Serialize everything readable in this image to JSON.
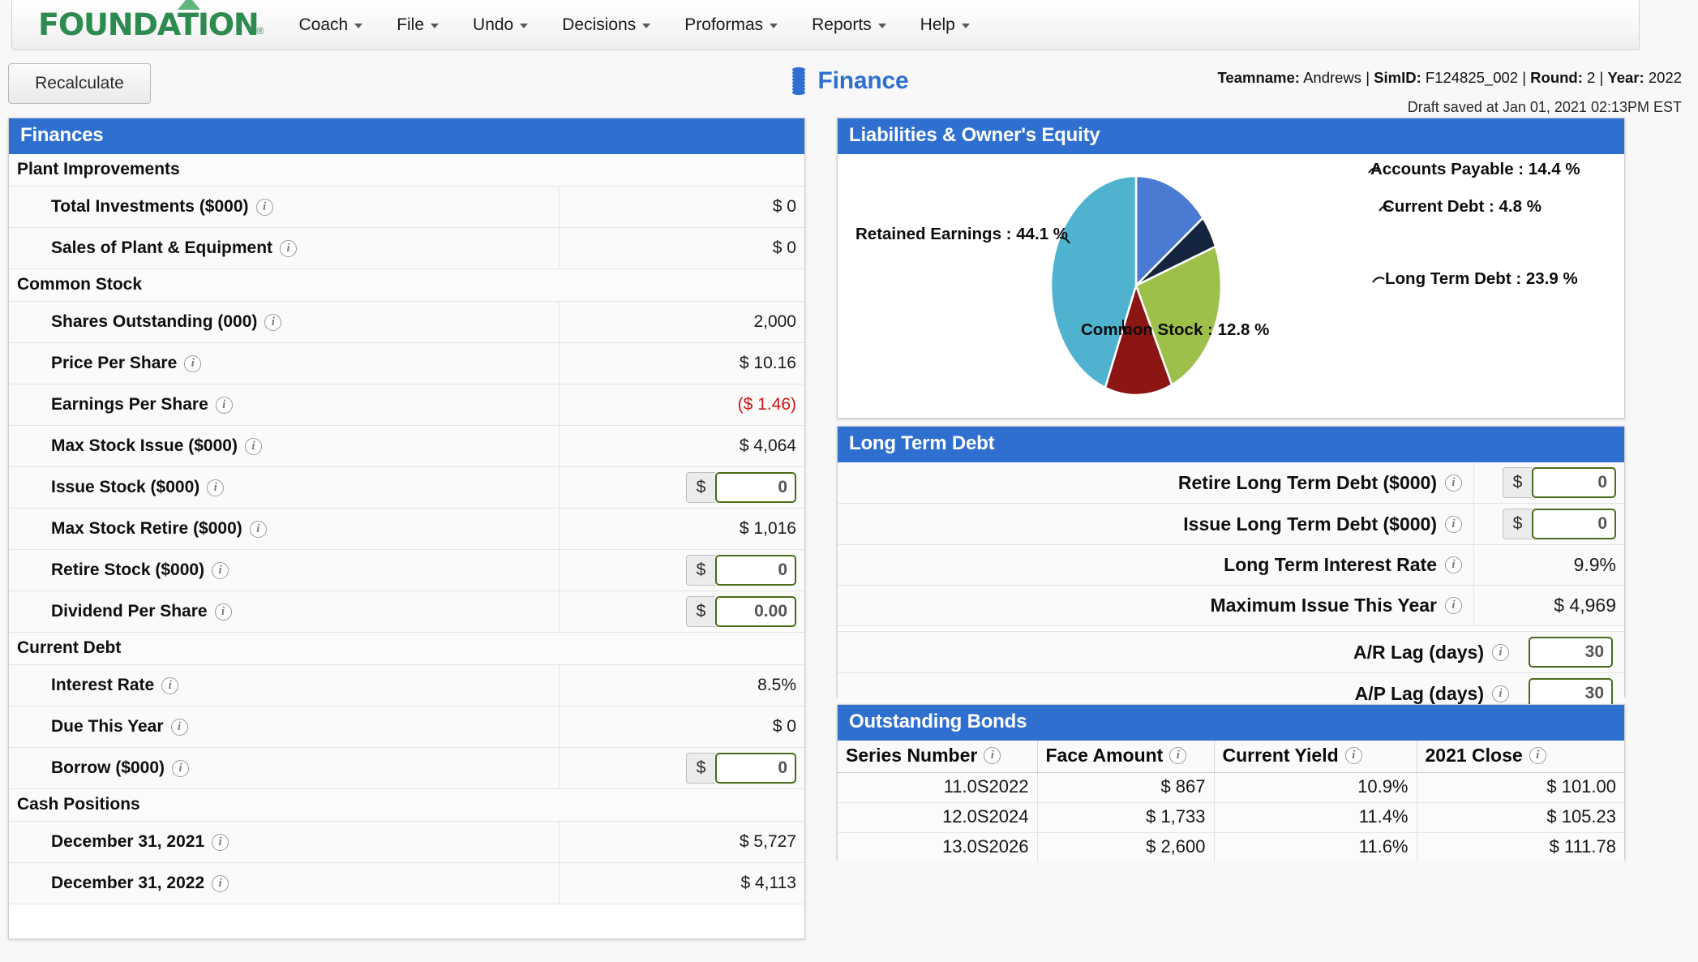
{
  "brand": {
    "name": "FOUNDATION",
    "registered": "®"
  },
  "menu": [
    {
      "label": "Coach"
    },
    {
      "label": "File"
    },
    {
      "label": "Undo"
    },
    {
      "label": "Decisions"
    },
    {
      "label": "Proformas"
    },
    {
      "label": "Reports"
    },
    {
      "label": "Help"
    }
  ],
  "toolbar": {
    "recalculate_label": "Recalculate"
  },
  "page": {
    "title": "Finance",
    "icon": "coins-icon",
    "title_color": "#2f6fd0"
  },
  "meta": {
    "teamname_label": "Teamname:",
    "teamname": "Andrews",
    "simid_label": "SimID:",
    "simid": "F124825_002",
    "round_label": "Round:",
    "round": "2",
    "year_label": "Year:",
    "year": "2022",
    "sep": "|",
    "draft_saved": "Draft saved at Jan 01, 2021 02:13PM EST"
  },
  "finances": {
    "title": "Finances",
    "groups": [
      {
        "name": "Plant Improvements",
        "rows": [
          {
            "label": "Total Investments ($000)",
            "value": "$ 0",
            "type": "text"
          },
          {
            "label": "Sales of Plant & Equipment",
            "value": "$ 0",
            "type": "text"
          }
        ]
      },
      {
        "name": "Common Stock",
        "rows": [
          {
            "label": "Shares Outstanding (000)",
            "value": "2,000",
            "type": "text"
          },
          {
            "label": "Price Per Share",
            "value": "$ 10.16",
            "type": "text"
          },
          {
            "label": "Earnings Per Share",
            "value": "($ 1.46)",
            "type": "text",
            "negative": true
          },
          {
            "label": "Max Stock Issue ($000)",
            "value": "$ 4,064",
            "type": "text"
          },
          {
            "label": "Issue Stock ($000)",
            "value": "0",
            "type": "input",
            "addon": "$"
          },
          {
            "label": "Max Stock Retire ($000)",
            "value": "$ 1,016",
            "type": "text"
          },
          {
            "label": "Retire Stock ($000)",
            "value": "0",
            "type": "input",
            "addon": "$"
          },
          {
            "label": "Dividend Per Share",
            "value": "0.00",
            "type": "input",
            "addon": "$"
          }
        ]
      },
      {
        "name": "Current Debt",
        "rows": [
          {
            "label": "Interest Rate",
            "value": "8.5%",
            "type": "text"
          },
          {
            "label": "Due This Year",
            "value": "$ 0",
            "type": "text"
          },
          {
            "label": "Borrow ($000)",
            "value": "0",
            "type": "input",
            "addon": "$"
          }
        ]
      },
      {
        "name": "Cash Positions",
        "rows": [
          {
            "label": "December 31, 2021",
            "value": "$ 5,727",
            "type": "text"
          },
          {
            "label": "December 31, 2022",
            "value": "$ 4,113",
            "type": "text"
          }
        ]
      }
    ]
  },
  "liabilities": {
    "title": "Liabilities & Owner's Equity"
  },
  "chart_data": {
    "type": "pie",
    "title": "Liabilities & Owner's Equity",
    "legend_position": "callout-labels",
    "categories": [
      "Accounts Payable",
      "Current Debt",
      "Long Term Debt",
      "Common Stock",
      "Retained Earnings"
    ],
    "values": [
      14.4,
      4.8,
      23.9,
      12.8,
      44.1
    ],
    "unit": "%",
    "labels": [
      {
        "name": "Accounts Payable",
        "value": 14.4,
        "text": "Accounts Payable : 14.4 %",
        "color": "#4a7ad2"
      },
      {
        "name": "Current Debt",
        "value": 4.8,
        "text": "Current Debt : 4.8 %",
        "color": "#16253f"
      },
      {
        "name": "Long Term Debt",
        "value": 23.9,
        "text": "Long Term Debt : 23.9 %",
        "color": "#9dc04a"
      },
      {
        "name": "Common Stock",
        "value": 12.8,
        "text": "Common Stock : 12.8 %",
        "color": "#8c1613"
      },
      {
        "name": "Retained Earnings",
        "value": 44.1,
        "text": "Retained Earnings : 44.1 %",
        "color": "#4fb3cf"
      }
    ]
  },
  "long_term_debt": {
    "title": "Long Term Debt",
    "rows": [
      {
        "label": "Retire Long Term Debt ($000)",
        "value": "0",
        "type": "input",
        "addon": "$"
      },
      {
        "label": "Issue Long Term Debt ($000)",
        "value": "0",
        "type": "input",
        "addon": "$"
      },
      {
        "label": "Long Term Interest Rate",
        "value": "9.9%",
        "type": "text"
      },
      {
        "label": "Maximum Issue This Year",
        "value": "$ 4,969",
        "type": "text"
      }
    ],
    "lags": [
      {
        "label": "A/R Lag (days)",
        "value": "30"
      },
      {
        "label": "A/P Lag (days)",
        "value": "30"
      }
    ]
  },
  "bonds": {
    "title": "Outstanding Bonds",
    "columns": [
      "Series Number",
      "Face Amount",
      "Current Yield",
      "2021 Close"
    ],
    "rows": [
      [
        "11.0S2022",
        "$ 867",
        "10.9%",
        "$ 101.00"
      ],
      [
        "12.0S2024",
        "$ 1,733",
        "11.4%",
        "$ 105.23"
      ],
      [
        "13.0S2026",
        "$ 2,600",
        "11.6%",
        "$ 111.78"
      ]
    ]
  }
}
